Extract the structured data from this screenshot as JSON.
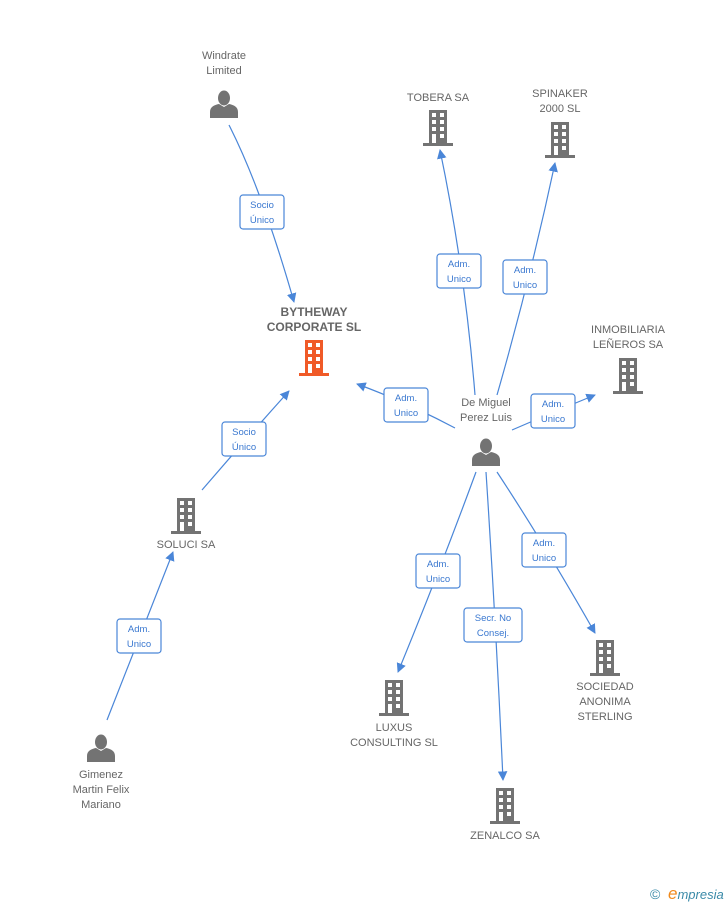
{
  "colors": {
    "edge": "#4a86d8",
    "node": "#737373",
    "focus": "#f05a28"
  },
  "nodes": {
    "windrate": {
      "lines": [
        "Windrate",
        "Limited"
      ],
      "type": "person"
    },
    "tobera": {
      "lines": [
        "TOBERA SA"
      ],
      "type": "company"
    },
    "spinaker": {
      "lines": [
        "SPINAKER",
        "2000 SL"
      ],
      "type": "company"
    },
    "bytheway": {
      "lines": [
        "BYTHEWAY",
        "CORPORATE SL"
      ],
      "type": "company",
      "focus": true
    },
    "inmobiliaria": {
      "lines": [
        "INMOBILIARIA",
        "LEÑEROS SA"
      ],
      "type": "company"
    },
    "demiguel": {
      "lines": [
        "De Miguel",
        "Perez Luis"
      ],
      "type": "person"
    },
    "soluci": {
      "lines": [
        "SOLUCI SA"
      ],
      "type": "company"
    },
    "luxus": {
      "lines": [
        "LUXUS",
        "CONSULTING  SL"
      ],
      "type": "company"
    },
    "sterling": {
      "lines": [
        "SOCIEDAD",
        "ANONIMA",
        "STERLING"
      ],
      "type": "company"
    },
    "zenalco": {
      "lines": [
        "ZENALCO SA"
      ],
      "type": "company"
    },
    "gimenez": {
      "lines": [
        "Gimenez",
        "Martin Felix",
        "Mariano"
      ],
      "type": "person"
    }
  },
  "edges": [
    {
      "from": "windrate",
      "to": "bytheway",
      "label": [
        "Socio",
        "Único"
      ]
    },
    {
      "from": "soluci",
      "to": "bytheway",
      "label": [
        "Socio",
        "Único"
      ]
    },
    {
      "from": "demiguel",
      "to": "bytheway",
      "label": [
        "Adm.",
        "Unico"
      ]
    },
    {
      "from": "demiguel",
      "to": "tobera",
      "label": [
        "Adm.",
        "Unico"
      ]
    },
    {
      "from": "demiguel",
      "to": "spinaker",
      "label": [
        "Adm.",
        "Unico"
      ]
    },
    {
      "from": "demiguel",
      "to": "inmobiliaria",
      "label": [
        "Adm.",
        "Unico"
      ]
    },
    {
      "from": "demiguel",
      "to": "luxus",
      "label": [
        "Adm.",
        "Unico"
      ]
    },
    {
      "from": "demiguel",
      "to": "zenalco",
      "label": [
        "Secr.  No",
        "Consej."
      ]
    },
    {
      "from": "demiguel",
      "to": "sterling",
      "label": [
        "Adm.",
        "Unico"
      ]
    },
    {
      "from": "gimenez",
      "to": "soluci",
      "label": [
        "Adm.",
        "Unico"
      ]
    }
  ],
  "footer": {
    "copyright": "©",
    "brand_initial": "e",
    "brand_rest": "mpresia"
  }
}
